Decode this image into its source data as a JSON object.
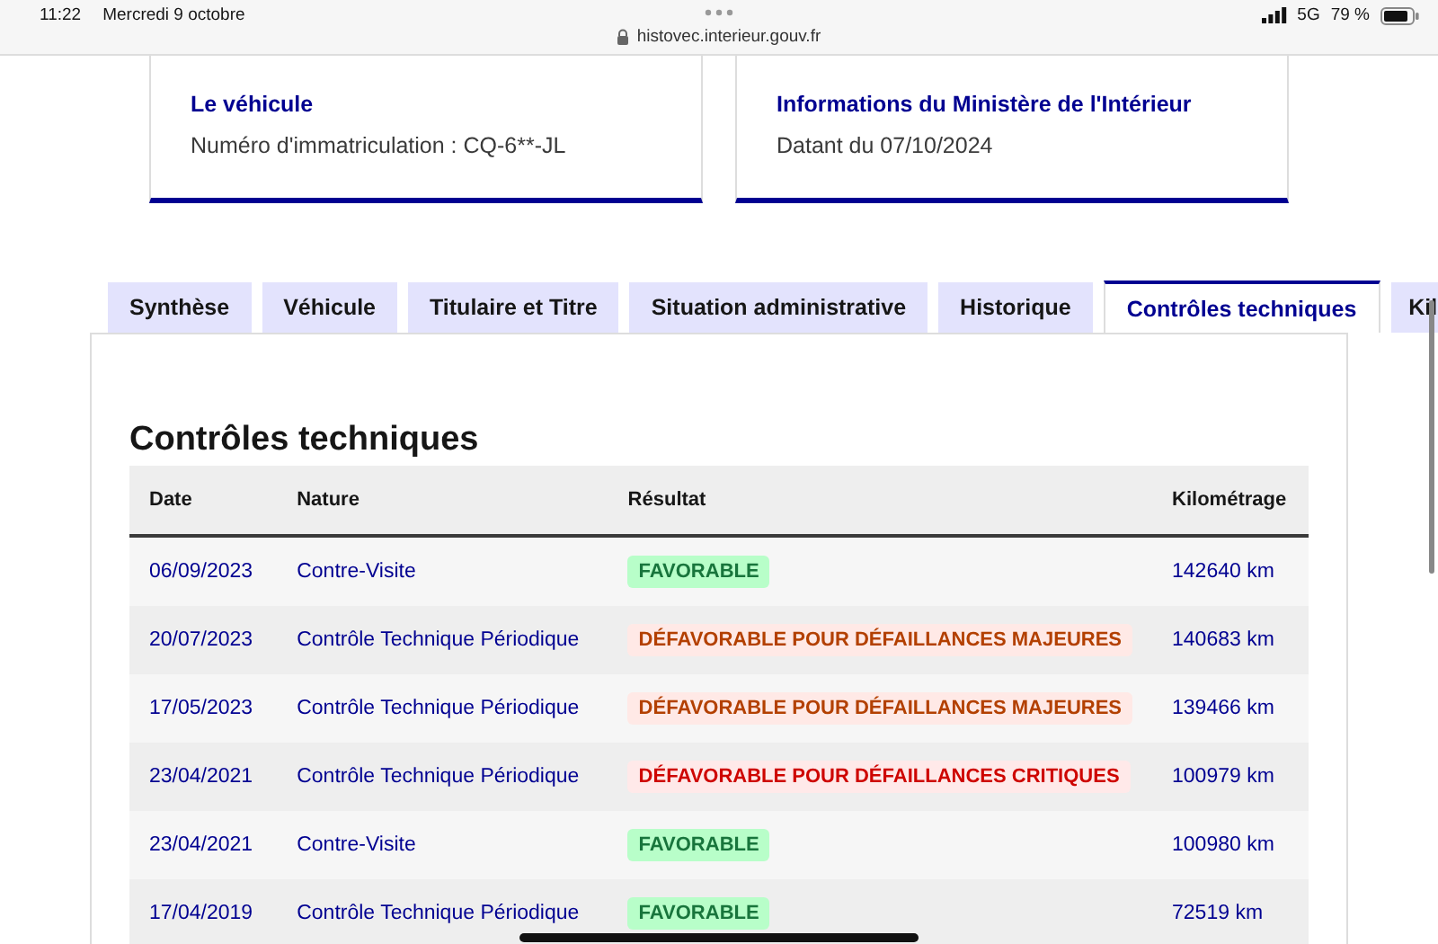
{
  "status_bar": {
    "time": "11:22",
    "date": "Mercredi 9 octobre",
    "url": "histovec.interieur.gouv.fr",
    "network": "5G",
    "battery": "79 %"
  },
  "cards": [
    {
      "title": "Le véhicule",
      "text": "Numéro d'immatriculation : CQ-6**-JL"
    },
    {
      "title": "Informations du Ministère de l'Intérieur",
      "text": "Datant du 07/10/2024"
    }
  ],
  "tabs": [
    {
      "label": "Synthèse",
      "selected": false
    },
    {
      "label": "Véhicule",
      "selected": false
    },
    {
      "label": "Titulaire et Titre",
      "selected": false
    },
    {
      "label": "Situation administrative",
      "selected": false
    },
    {
      "label": "Historique",
      "selected": false
    },
    {
      "label": "Contrôles techniques",
      "selected": true
    },
    {
      "label": "Kil",
      "selected": false
    }
  ],
  "section_title": "Contrôles techniques",
  "table": {
    "columns": [
      "Date",
      "Nature",
      "Résultat",
      "Kilométrage"
    ],
    "rows": [
      {
        "date": "06/09/2023",
        "nature": "Contre-Visite",
        "result": "FAVORABLE",
        "kind": "favorable",
        "km": "142640 km"
      },
      {
        "date": "20/07/2023",
        "nature": "Contrôle Technique Périodique",
        "result": "DÉFAVORABLE POUR DÉFAILLANCES MAJEURES",
        "kind": "major",
        "km": "140683 km"
      },
      {
        "date": "17/05/2023",
        "nature": "Contrôle Technique Périodique",
        "result": "DÉFAVORABLE POUR DÉFAILLANCES MAJEURES",
        "kind": "major",
        "km": "139466 km"
      },
      {
        "date": "23/04/2021",
        "nature": "Contrôle Technique Périodique",
        "result": "DÉFAVORABLE POUR DÉFAILLANCES CRITIQUES",
        "kind": "critical",
        "km": "100979 km"
      },
      {
        "date": "23/04/2021",
        "nature": "Contre-Visite",
        "result": "FAVORABLE",
        "kind": "favorable",
        "km": "100980 km"
      },
      {
        "date": "17/04/2019",
        "nature": "Contrôle Technique Périodique",
        "result": "FAVORABLE",
        "kind": "favorable",
        "km": "72519 km"
      }
    ]
  }
}
